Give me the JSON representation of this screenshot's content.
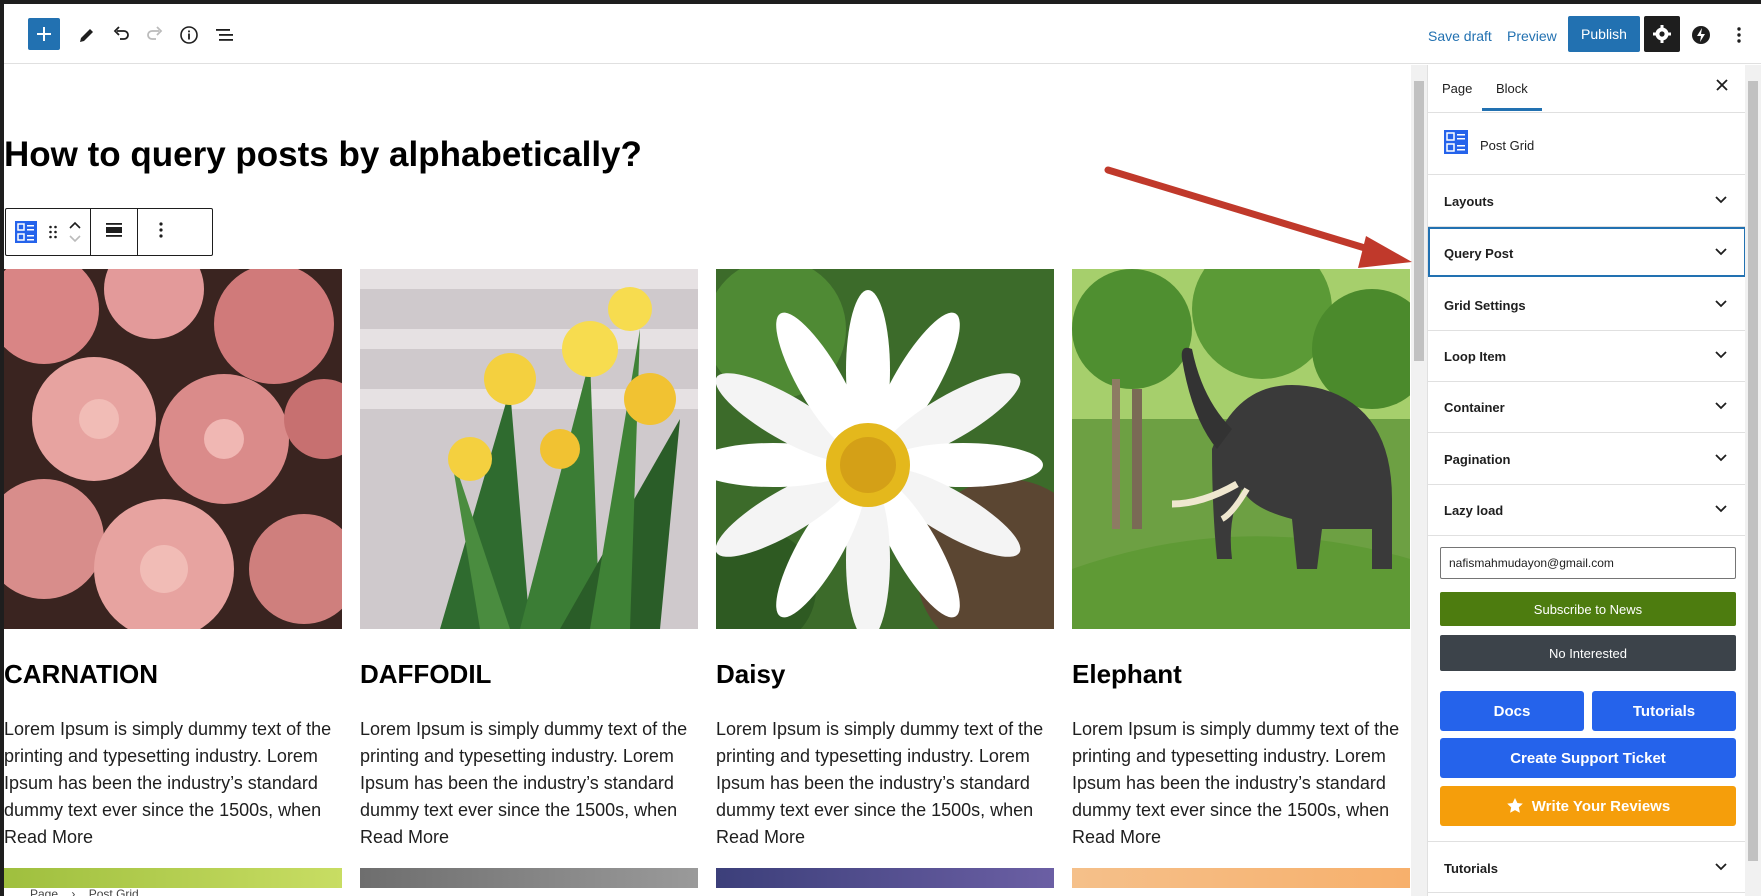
{
  "toolbar": {
    "save_draft": "Save draft",
    "preview": "Preview",
    "publish": "Publish"
  },
  "page": {
    "title": "How to query posts by alphabetically?"
  },
  "posts": [
    {
      "title": "CARNATION",
      "excerpt": "Lorem Ipsum is simply dummy text of the printing and typesetting industry. Lorem Ipsum has been the industry’s standard dummy text ever since the 1500s, when",
      "read_more": "Read More"
    },
    {
      "title": "DAFFODIL",
      "excerpt": "Lorem Ipsum is simply dummy text of the printing and typesetting industry. Lorem Ipsum has been the industry’s standard dummy text ever since the 1500s, when",
      "read_more": "Read More"
    },
    {
      "title": "Daisy",
      "excerpt": "Lorem Ipsum is simply dummy text of the printing and typesetting industry. Lorem Ipsum has been the industry’s standard dummy text ever since the 1500s, when",
      "read_more": "Read More"
    },
    {
      "title": "Elephant",
      "excerpt": "Lorem Ipsum is simply dummy text of the printing and typesetting industry. Lorem Ipsum has been the industry’s standard dummy text ever since the 1500s, when",
      "read_more": "Read More"
    }
  ],
  "breadcrumb": {
    "page": "Page",
    "sep": "›",
    "block": "Post Grid"
  },
  "sidebar": {
    "tabs": [
      "Page",
      "Block"
    ],
    "active_tab": "Block",
    "block_name": "Post Grid",
    "panels": [
      "Layouts",
      "Query Post",
      "Grid Settings",
      "Loop Item",
      "Container",
      "Pagination",
      "Lazy load"
    ],
    "focused_panel": "Query Post",
    "email_value": "nafismahmudayon@gmail.com",
    "subscribe_label": "Subscribe to News",
    "no_interest_label": "No Interested",
    "docs_label": "Docs",
    "tutorials_btn_label": "Tutorials",
    "support_label": "Create Support Ticket",
    "reviews_label": "Write Your Reviews",
    "bottom_panel": "Tutorials"
  },
  "colors": {
    "wp_blue": "#2271b1",
    "subscribe_green": "#4d7c0f",
    "no_interest_gray": "#3c434a",
    "action_blue": "#2563eb",
    "review_orange": "#f59e0b",
    "annotation_arrow": "#c0392b"
  },
  "icons": [
    "plus-icon",
    "pen-icon",
    "undo-icon",
    "redo-icon",
    "info-icon",
    "list-view-icon",
    "gear-icon",
    "jetpack-icon",
    "more-vertical-icon",
    "close-icon",
    "chevron-down-icon",
    "post-grid-icon",
    "drag-icon",
    "move-up-icon",
    "move-down-icon",
    "align-icon",
    "star-icon"
  ]
}
